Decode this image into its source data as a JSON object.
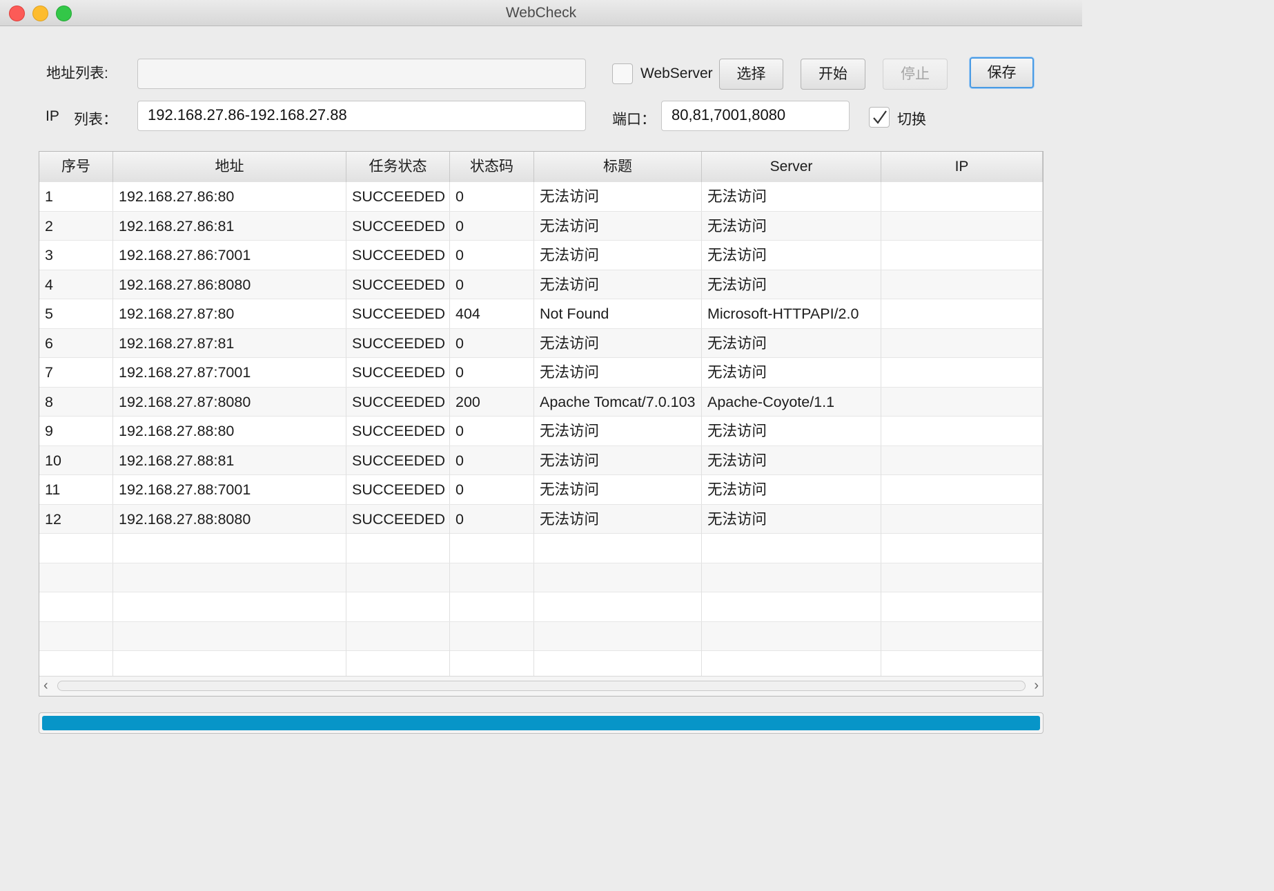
{
  "window": {
    "title": "WebCheck"
  },
  "form": {
    "address_label": "地址列表:",
    "address_value": "",
    "ip_label_1": "IP",
    "ip_label_2": "列表：",
    "ip_value": "192.168.27.86-192.168.27.88",
    "webserver_label": "WebServer",
    "webserver_checked": false,
    "port_label": "端口：",
    "port_value": "80,81,7001,8080",
    "switch_label": "切换",
    "switch_checked": true
  },
  "buttons": {
    "select": "选择",
    "start": "开始",
    "stop": "停止",
    "save": "保存"
  },
  "table": {
    "columns": [
      "序号",
      "地址",
      "任务状态",
      "状态码",
      "标题",
      "Server",
      "IP"
    ],
    "rows": [
      [
        "1",
        "192.168.27.86:80",
        "SUCCEEDED",
        "0",
        "无法访问",
        "无法访问",
        ""
      ],
      [
        "2",
        "192.168.27.86:81",
        "SUCCEEDED",
        "0",
        "无法访问",
        "无法访问",
        ""
      ],
      [
        "3",
        "192.168.27.86:7001",
        "SUCCEEDED",
        "0",
        "无法访问",
        "无法访问",
        ""
      ],
      [
        "4",
        "192.168.27.86:8080",
        "SUCCEEDED",
        "0",
        "无法访问",
        "无法访问",
        ""
      ],
      [
        "5",
        "192.168.27.87:80",
        "SUCCEEDED",
        "404",
        "Not Found",
        "Microsoft-HTTPAPI/2.0",
        ""
      ],
      [
        "6",
        "192.168.27.87:81",
        "SUCCEEDED",
        "0",
        "无法访问",
        "无法访问",
        ""
      ],
      [
        "7",
        "192.168.27.87:7001",
        "SUCCEEDED",
        "0",
        "无法访问",
        "无法访问",
        ""
      ],
      [
        "8",
        "192.168.27.87:8080",
        "SUCCEEDED",
        "200",
        "Apache Tomcat/7.0.103",
        "Apache-Coyote/1.1",
        ""
      ],
      [
        "9",
        "192.168.27.88:80",
        "SUCCEEDED",
        "0",
        "无法访问",
        "无法访问",
        ""
      ],
      [
        "10",
        "192.168.27.88:81",
        "SUCCEEDED",
        "0",
        "无法访问",
        "无法访问",
        ""
      ],
      [
        "11",
        "192.168.27.88:7001",
        "SUCCEEDED",
        "0",
        "无法访问",
        "无法访问",
        ""
      ],
      [
        "12",
        "192.168.27.88:8080",
        "SUCCEEDED",
        "0",
        "无法访问",
        "无法访问",
        ""
      ]
    ]
  },
  "progress": {
    "value": 1.0,
    "color": "#0795c8"
  }
}
